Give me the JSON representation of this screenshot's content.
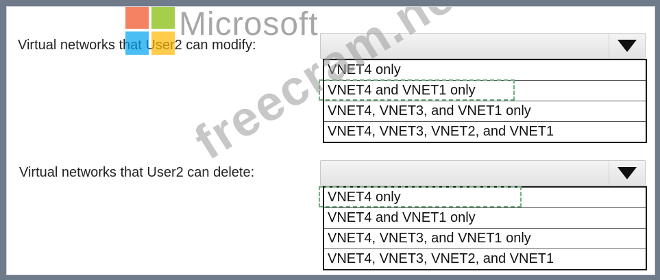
{
  "watermark_logo": {
    "text": "Microsoft"
  },
  "watermark_site": {
    "text": "freecram.net"
  },
  "questions": [
    {
      "label": "Virtual networks that User2 can modify:",
      "options": [
        "VNET4 only",
        "VNET4 and VNET1 only",
        "VNET4, VNET3, and VNET1 only",
        "VNET4, VNET3, VNET2, and VNET1"
      ],
      "highlighted_option": "VNET4 and VNET1 only"
    },
    {
      "label": "Virtual networks that User2 can delete:",
      "options": [
        "VNET4 only",
        "VNET4 and VNET1 only",
        "VNET4, VNET3, and VNET1 only",
        "VNET4, VNET3, VNET2, and VNET1"
      ],
      "highlighted_option": "VNET4 only"
    }
  ],
  "colors": {
    "border_bg": "#6f7a8a",
    "highlight_dash": "#6fae7d"
  }
}
